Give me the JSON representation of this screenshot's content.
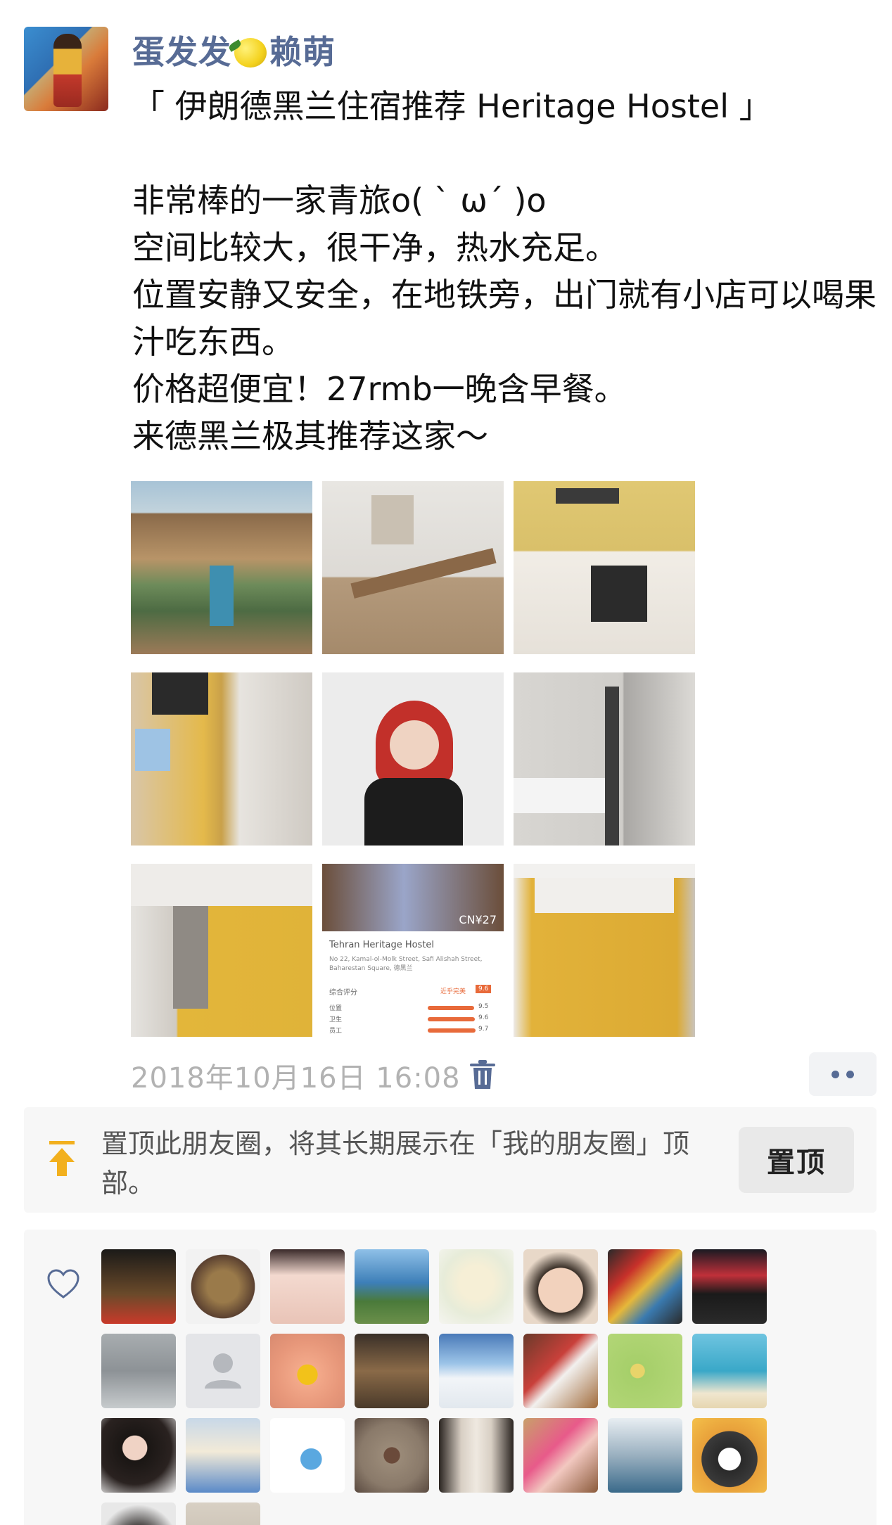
{
  "post": {
    "username": "蛋发发",
    "username_suffix": "赖萌",
    "lemon_icon": "lemon-emoji-icon",
    "text": "「 伊朗德黑兰住宿推荐 Heritage Hostel 」\n\n非常棒的一家青旅o( ` ω´ )o\n空间比较大，很干净，热水充足。\n位置安静又安全，在地铁旁，出门就有小店可以喝果汁吃东西。\n价格超便宜！27rmb一晚含早餐。\n来德黑兰极其推荐这家～",
    "timestamp": "2018年10月16日 16:08",
    "photo_card": {
      "price_tag": "CN¥27",
      "hostel_name": "Tehran Heritage Hostel",
      "address": "No 22, Kamal-ol-Molk Street, Safi Alishah Street, Baharestan Square, 德黑兰",
      "rating_label": "综合评分",
      "rating_tag": "近乎完美",
      "rating_score": "9.6",
      "rows": [
        {
          "label": "位置",
          "score": "9.5"
        },
        {
          "label": "卫生",
          "score": "9.6"
        },
        {
          "label": "员工",
          "score": "9.7"
        }
      ]
    }
  },
  "pin": {
    "text": "置顶此朋友圈，将其长期展示在「我的朋友圈」顶部。",
    "button": "置顶"
  },
  "colors": {
    "name_blue": "#576b95",
    "timestamp_gray": "#b2b2b2",
    "panel_bg": "#f7f7f7",
    "pin_icon": "#f2b01e"
  }
}
